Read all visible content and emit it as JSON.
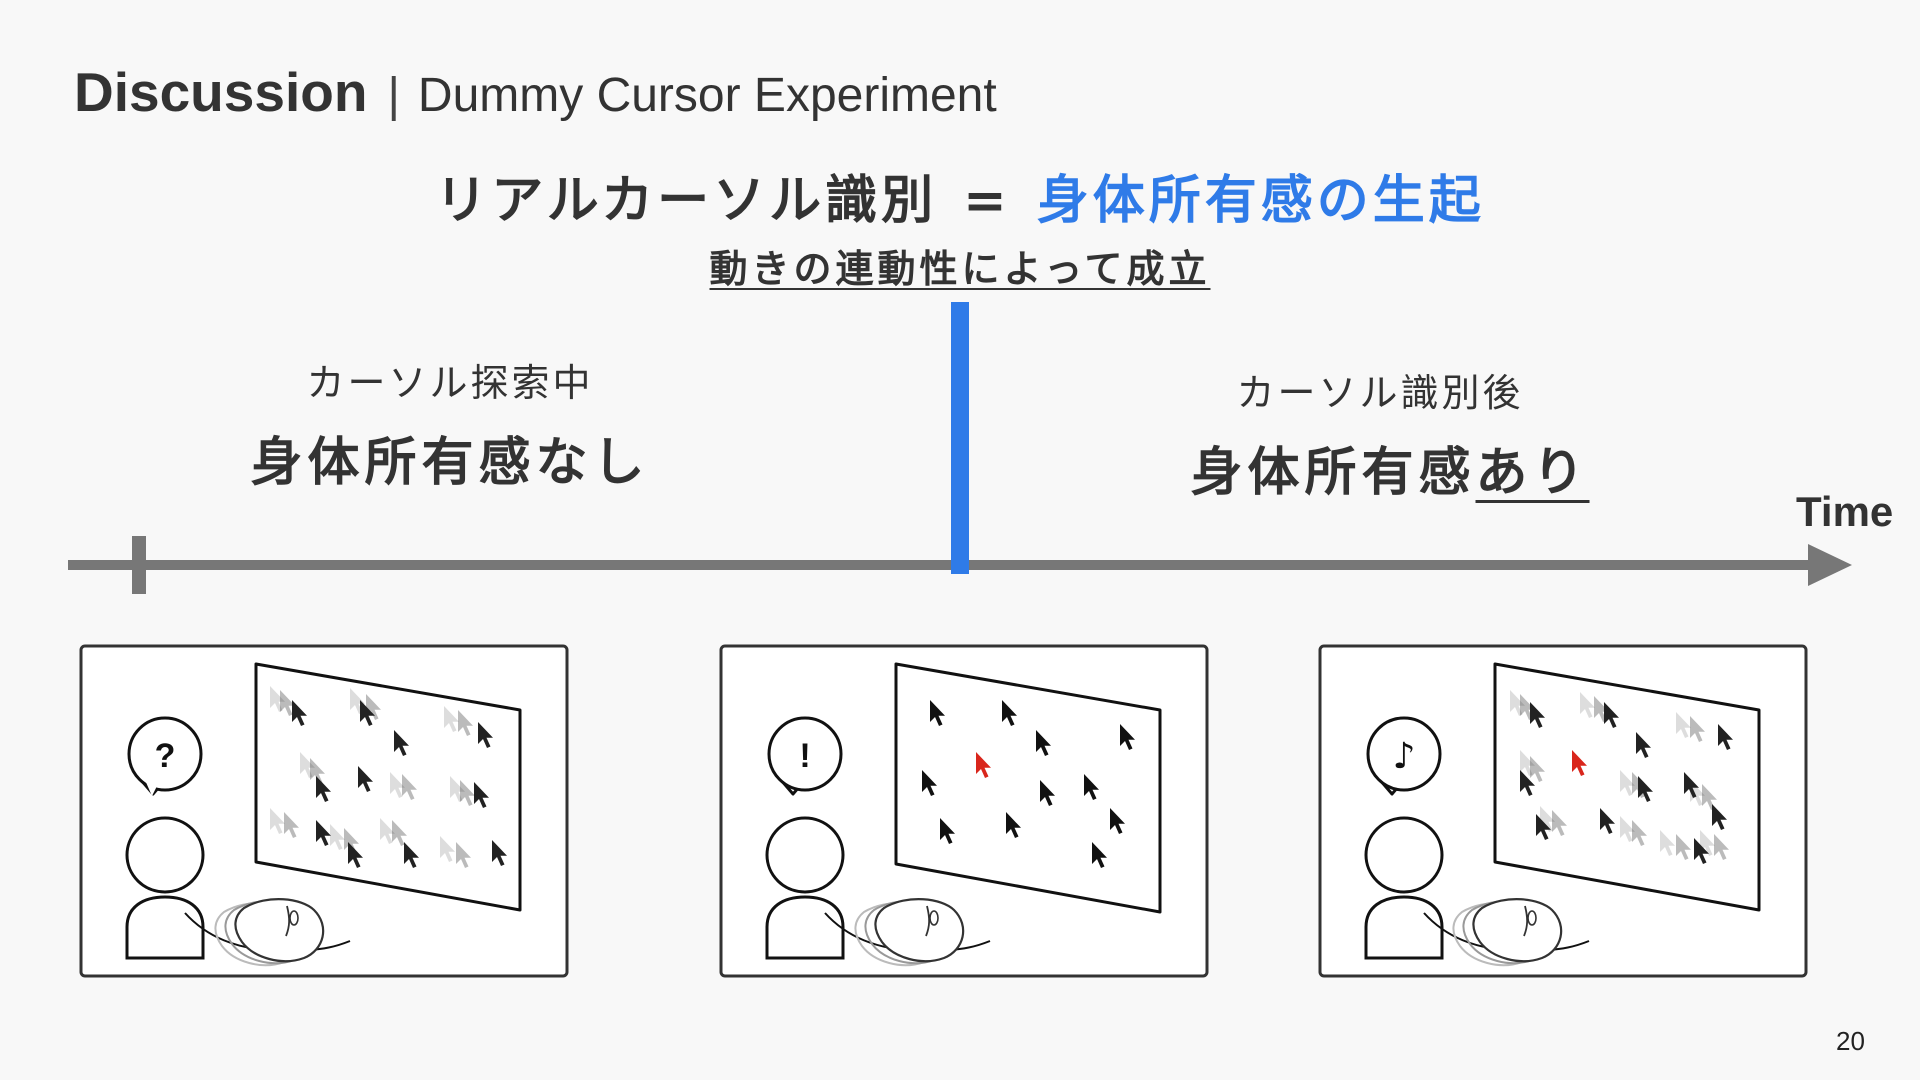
{
  "slide": {
    "title_main": "Discussion",
    "title_separator": "|",
    "title_sub": "Dummy Cursor Experiment",
    "headline_left": "リアルカーソル識別",
    "headline_eq": "=",
    "headline_right": "身体所有感の生起",
    "subline": "動きの連動性によって成立",
    "left_state_small": "カーソル探索中",
    "left_state_big": "身体所有感なし",
    "right_state_small": "カーソル識別後",
    "right_state_big_prefix": "身体所有感",
    "right_state_big_underlined": "あり",
    "axis_label": "Time",
    "page_number": "20"
  },
  "panels": [
    {
      "bubble_symbol": "?"
    },
    {
      "bubble_symbol": "!"
    },
    {
      "bubble_symbol": "♪"
    }
  ],
  "colors": {
    "accent_blue": "#2f7be8",
    "axis_gray": "#777777",
    "real_cursor_red": "#d9261c",
    "background": "#f8f8f8"
  }
}
